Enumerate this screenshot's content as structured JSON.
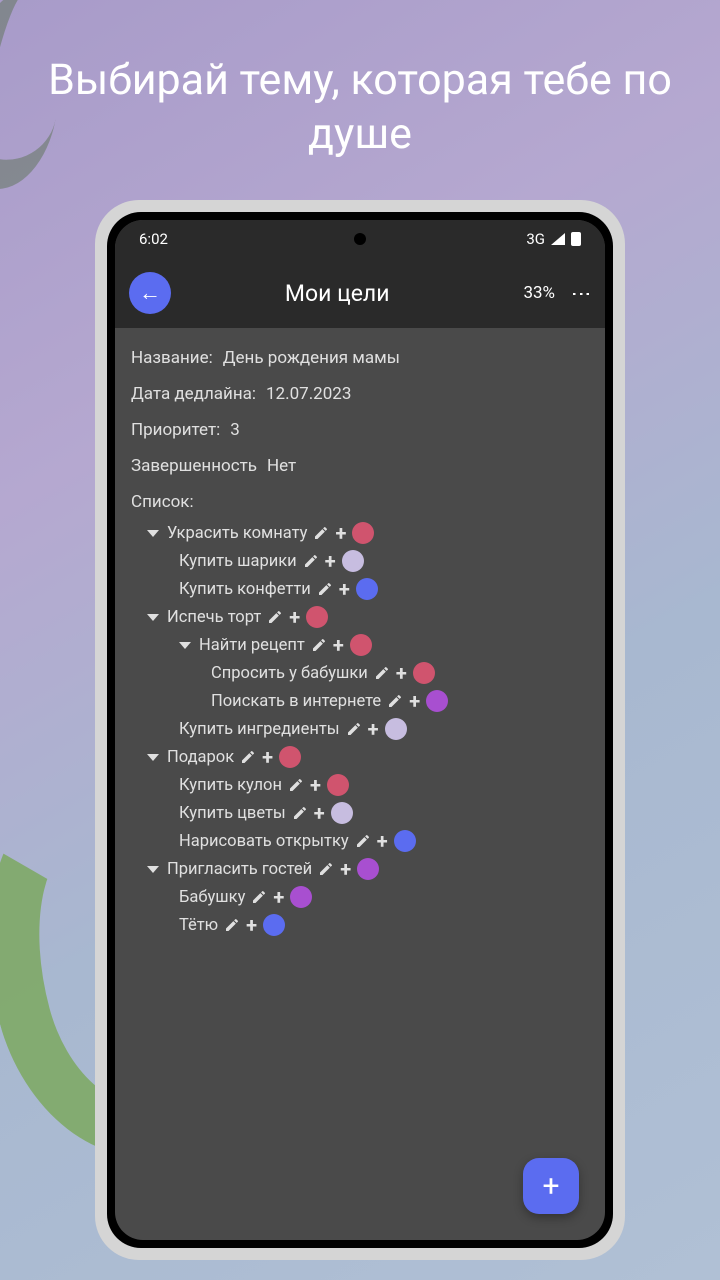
{
  "promo": {
    "headline": "Выбирай тему, которая тебе по душе"
  },
  "status": {
    "time": "6:02",
    "network": "3G"
  },
  "appbar": {
    "title": "Мои цели",
    "percent": "33%"
  },
  "fields": {
    "name_label": "Название:",
    "name_value": "День рождения мамы",
    "deadline_label": "Дата дедлайна:",
    "deadline_value": "12.07.2023",
    "priority_label": "Приоритет:",
    "priority_value": "3",
    "complete_label": "Завершенность",
    "complete_value": "Нет",
    "list_label": "Список:"
  },
  "colors": {
    "pink": "#d0546e",
    "lilac": "#c7bde0",
    "blue": "#5b6cf0",
    "purple": "#a84fd0"
  },
  "tree": [
    {
      "text": "Украсить комнату",
      "level": 0,
      "hasCaret": true,
      "color": "pink"
    },
    {
      "text": "Купить шарики",
      "level": 1,
      "hasCaret": false,
      "color": "lilac"
    },
    {
      "text": "Купить конфетти",
      "level": 1,
      "hasCaret": false,
      "color": "blue"
    },
    {
      "text": "Испечь торт",
      "level": 0,
      "hasCaret": true,
      "color": "pink"
    },
    {
      "text": "Найти рецепт",
      "level": 1,
      "hasCaret": true,
      "color": "pink"
    },
    {
      "text": "Спросить у бабушки",
      "level": 2,
      "hasCaret": false,
      "color": "pink"
    },
    {
      "text": "Поискать в интернете",
      "level": 2,
      "hasCaret": false,
      "color": "purple"
    },
    {
      "text": "Купить ингредиенты",
      "level": 1,
      "hasCaret": false,
      "color": "lilac"
    },
    {
      "text": "Подарок",
      "level": 0,
      "hasCaret": true,
      "color": "pink"
    },
    {
      "text": "Купить кулон",
      "level": 1,
      "hasCaret": false,
      "color": "pink"
    },
    {
      "text": "Купить цветы",
      "level": 1,
      "hasCaret": false,
      "color": "lilac"
    },
    {
      "text": "Нарисовать открытку",
      "level": 1,
      "hasCaret": false,
      "color": "blue"
    },
    {
      "text": "Пригласить гостей",
      "level": 0,
      "hasCaret": true,
      "color": "purple"
    },
    {
      "text": "Бабушку",
      "level": 1,
      "hasCaret": false,
      "color": "purple"
    },
    {
      "text": "Тётю",
      "level": 1,
      "hasCaret": false,
      "color": "blue"
    }
  ],
  "fab": {
    "label": "+"
  }
}
